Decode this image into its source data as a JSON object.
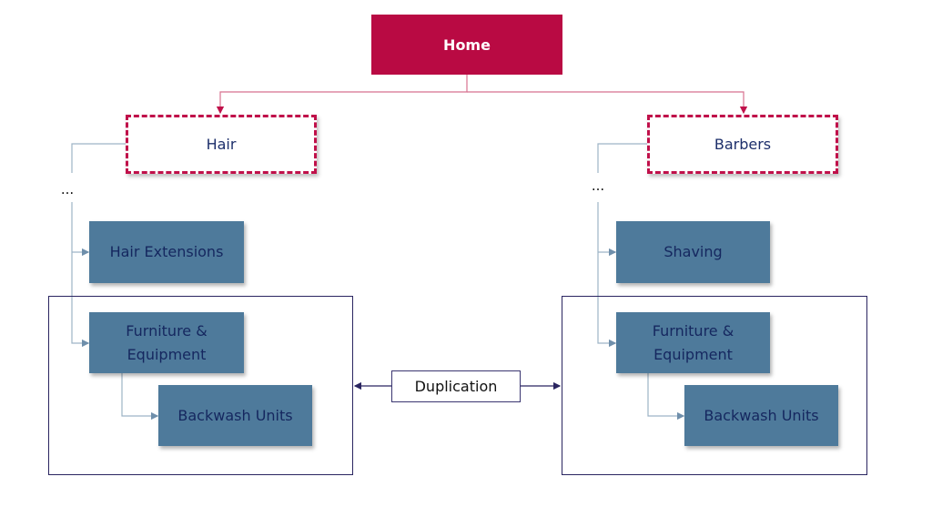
{
  "root": {
    "label": "Home"
  },
  "branches": [
    {
      "label": "Hair",
      "ellipsis": "...",
      "children": [
        "Hair Extensions",
        "Furniture & Equipment"
      ],
      "grandchild": "Backwash Units"
    },
    {
      "label": "Barbers",
      "ellipsis": "...",
      "children": [
        "Shaving",
        "Furniture & Equipment"
      ],
      "grandchild": "Backwash Units"
    }
  ],
  "duplication_label": "Duplication",
  "colors": {
    "root": "#b90a43",
    "category_border": "#c0104a",
    "subcategory": "#4e7a9b",
    "text": "#15275f"
  }
}
